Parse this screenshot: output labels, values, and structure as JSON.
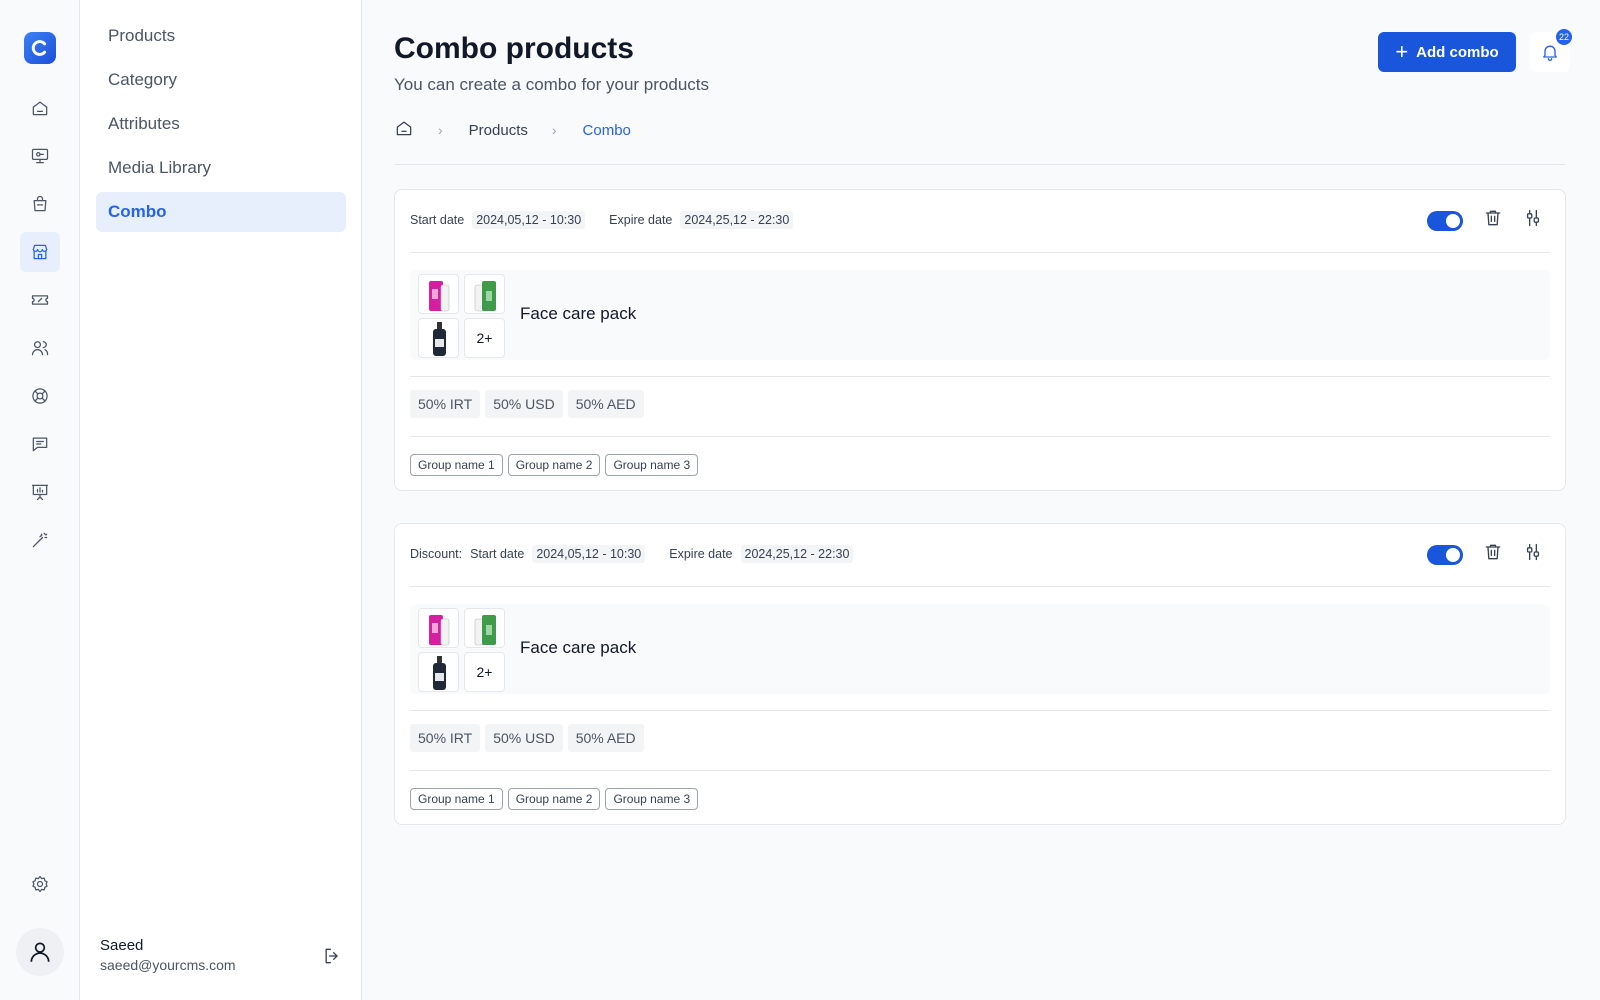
{
  "sidebar": {
    "items": [
      {
        "name": "home",
        "icon": "home-icon"
      },
      {
        "name": "products-monitor",
        "icon": "monitor-tag-icon"
      },
      {
        "name": "orders",
        "icon": "shopping-bag-icon"
      },
      {
        "name": "store",
        "icon": "storefront-icon",
        "active": true
      },
      {
        "name": "tickets",
        "icon": "ticket-icon"
      },
      {
        "name": "users",
        "icon": "users-icon"
      },
      {
        "name": "support",
        "icon": "lifebuoy-icon"
      },
      {
        "name": "messages",
        "icon": "chat-icon"
      },
      {
        "name": "reports",
        "icon": "presentation-chart-icon"
      },
      {
        "name": "tools",
        "icon": "magic-wand-icon"
      }
    ],
    "settings_icon": "gear-icon"
  },
  "subnav": {
    "items": [
      {
        "label": "Products"
      },
      {
        "label": "Category"
      },
      {
        "label": "Attributes"
      },
      {
        "label": "Media Library"
      },
      {
        "label": "Combo",
        "active": true
      }
    ],
    "user": {
      "name": "Saeed",
      "email": "saeed@yourcms.com"
    }
  },
  "header": {
    "title": "Combo products",
    "subtitle": "You can create a combo for your products",
    "add_label": "Add combo",
    "notification_count": "22"
  },
  "breadcrumb": {
    "items": [
      "Products",
      "Combo"
    ]
  },
  "combos": [
    {
      "prefix": "",
      "start_label": "Start date",
      "start_value": "2024,05,12 - 10:30",
      "expire_label": "Expire date",
      "expire_value": "2024,25,12 - 22:30",
      "enabled": true,
      "pack_name": "Face care pack",
      "more_count": "2+",
      "prices": [
        "50% IRT",
        "50% USD",
        "50% AED"
      ],
      "groups": [
        "Group name 1",
        "Group name 2",
        "Group name 3"
      ]
    },
    {
      "prefix": "Discount:",
      "start_label": "Start date",
      "start_value": "2024,05,12 - 10:30",
      "expire_label": "Expire date",
      "expire_value": "2024,25,12 - 22:30",
      "enabled": true,
      "pack_name": "Face care pack",
      "more_count": "2+",
      "prices": [
        "50% IRT",
        "50% USD",
        "50% AED"
      ],
      "groups": [
        "Group name 1",
        "Group name 2",
        "Group name 3"
      ]
    }
  ],
  "colors": {
    "accent": "#1a56db",
    "active_bg": "#e8effc",
    "chip_bg": "#f3f4f6",
    "border": "#e5e7eb"
  }
}
